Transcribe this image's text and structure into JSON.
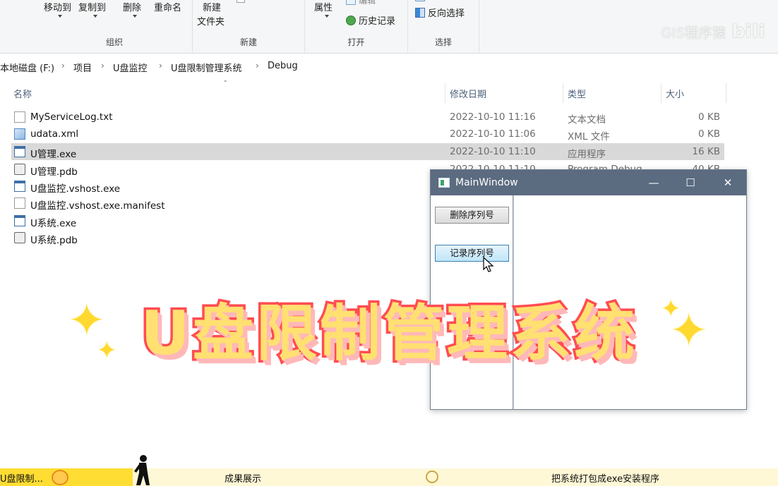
{
  "ribbon": {
    "organize": {
      "move_to": "移动到",
      "copy_to": "复制到",
      "delete": "删除",
      "rename": "重命名",
      "caption": "组织"
    },
    "new": {
      "new_folder_line1": "新建",
      "new_folder_line2": "文件夹",
      "caption": "新建"
    },
    "open": {
      "properties": "属性",
      "edit": "编辑",
      "history": "历史记录",
      "caption": "打开"
    },
    "select": {
      "invert": "反向选择",
      "caption": "选择"
    }
  },
  "watermark": {
    "text": "GIS程序猿",
    "brand": "bili"
  },
  "breadcrumb": [
    "本地磁盘 (F:)",
    "项目",
    "U盘监控",
    "U盘限制管理系统",
    "Debug"
  ],
  "columns": {
    "name": "名称",
    "modified": "修改日期",
    "type": "类型",
    "size": "大小"
  },
  "files": [
    {
      "name": "MyServiceLog.txt",
      "modified": "2022-10-10 11:16",
      "type": "文本文档",
      "size": "0 KB"
    },
    {
      "name": "udata.xml",
      "modified": "2022-10-10 11:06",
      "type": "XML 文件",
      "size": "0 KB"
    },
    {
      "name": "U管理.exe",
      "modified": "2022-10-10 11:10",
      "type": "应用程序",
      "size": "16 KB"
    },
    {
      "name": "U管理.pdb",
      "modified": "2022-10-10 11:10",
      "type": "Program Debug",
      "size": "40 KB"
    },
    {
      "name": "U盘监控.vshost.exe"
    },
    {
      "name": "U盘监控.vshost.exe.manifest"
    },
    {
      "name": "U系统.exe"
    },
    {
      "name": "U系统.pdb"
    }
  ],
  "main_window": {
    "title": "MainWindow",
    "buttons": {
      "delete_serial": "删除序列号",
      "record_serial": "记录序列号"
    }
  },
  "overlay_title": "U盘限制管理系统",
  "bottom_bar": {
    "current": "U盘限制...",
    "segment2": "成果展示",
    "segment3": "把系统打包成exe安装程序"
  },
  "colors": {
    "title_fill": "#ffe071",
    "title_stroke": "#ff4c52",
    "window_titlebar": "#5b6b80",
    "selection": "#d9d9d9",
    "bar_highlight": "#ffdd33"
  }
}
